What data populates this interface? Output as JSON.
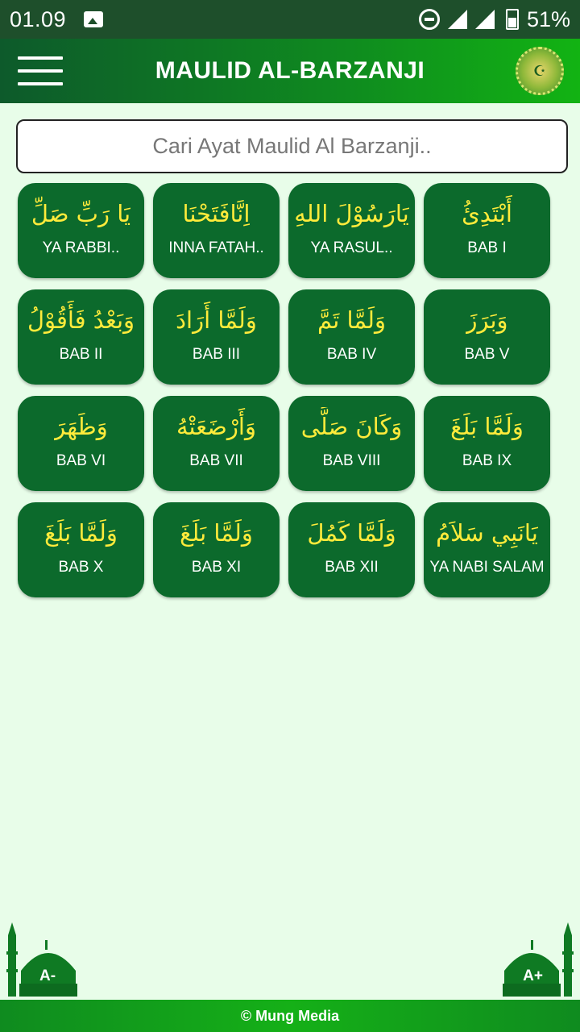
{
  "status_bar": {
    "time": "01.09",
    "battery": "51%",
    "icons": [
      "image-icon",
      "dnd-icon",
      "signal-icon",
      "signal-icon",
      "battery-icon"
    ]
  },
  "app_bar": {
    "title": "MAULID AL-BARZANJI",
    "menu_icon": "hamburger-icon",
    "logo": "muhammad-calligraphy-logo"
  },
  "search": {
    "placeholder": "Cari Ayat Maulid Al Barzanji..",
    "value": ""
  },
  "tiles": [
    {
      "arabic": "يَا رَبِّ صَلِّ",
      "label": "YA RABBI.."
    },
    {
      "arabic": "اِنَّافَتَحْنَا",
      "label": "INNA FATAH.."
    },
    {
      "arabic": "يَارَسُوْلَ اللهِ",
      "label": "YA RASUL.."
    },
    {
      "arabic": "أَبْتَدِئُ",
      "label": "BAB I"
    },
    {
      "arabic": "وَبَعْدُ فَأَقُوْلُ",
      "label": "BAB II"
    },
    {
      "arabic": "وَلَمَّا أَرَادَ",
      "label": "BAB III"
    },
    {
      "arabic": "وَلَمَّا تَمَّ",
      "label": "BAB IV"
    },
    {
      "arabic": "وَبَرَزَ",
      "label": "BAB V"
    },
    {
      "arabic": "وَظَهَرَ",
      "label": "BAB VI"
    },
    {
      "arabic": "وَأَرْضَعَتْهُ",
      "label": "BAB VII"
    },
    {
      "arabic": "وَكَانَ صَلَّى",
      "label": "BAB VIII"
    },
    {
      "arabic": "وَلَمَّا بَلَغَ",
      "label": "BAB IX"
    },
    {
      "arabic": "وَلَمَّا بَلَغَ",
      "label": "BAB X"
    },
    {
      "arabic": "وَلَمَّا بَلَغَ",
      "label": "BAB XI"
    },
    {
      "arabic": "وَلَمَّا كَمُلَ",
      "label": "BAB XII"
    },
    {
      "arabic": "يَانَبِي سَلاَمُ",
      "label": "YA NABI SALAM"
    }
  ],
  "font_controls": {
    "decrease": "A-",
    "increase": "A+"
  },
  "footer": {
    "text": "© Mung Media"
  },
  "colors": {
    "status_bar": "#1e4f2b",
    "tile_bg": "#0c6a2c",
    "arabic_text": "#ffeb3b",
    "page_bg": "#e8fde9",
    "app_bar_start": "#0d5a2b",
    "app_bar_end": "#12b313"
  }
}
